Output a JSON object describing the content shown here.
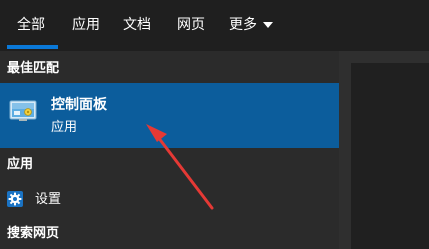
{
  "tabs": [
    {
      "label": "全部",
      "active": true
    },
    {
      "label": "应用"
    },
    {
      "label": "文档"
    },
    {
      "label": "网页"
    },
    {
      "label": "更多"
    }
  ],
  "sections": {
    "best_match": "最佳匹配",
    "apps": "应用",
    "web_search": "搜索网页"
  },
  "best_match_item": {
    "title": "控制面板",
    "subtitle": "应用",
    "icon": "control-panel-icon"
  },
  "app_items": [
    {
      "label": "设置",
      "icon": "gear-icon"
    }
  ],
  "colors": {
    "accent": "#0a78d7",
    "selected_bg": "#0c5d9c",
    "annotation_arrow": "#e53935"
  }
}
